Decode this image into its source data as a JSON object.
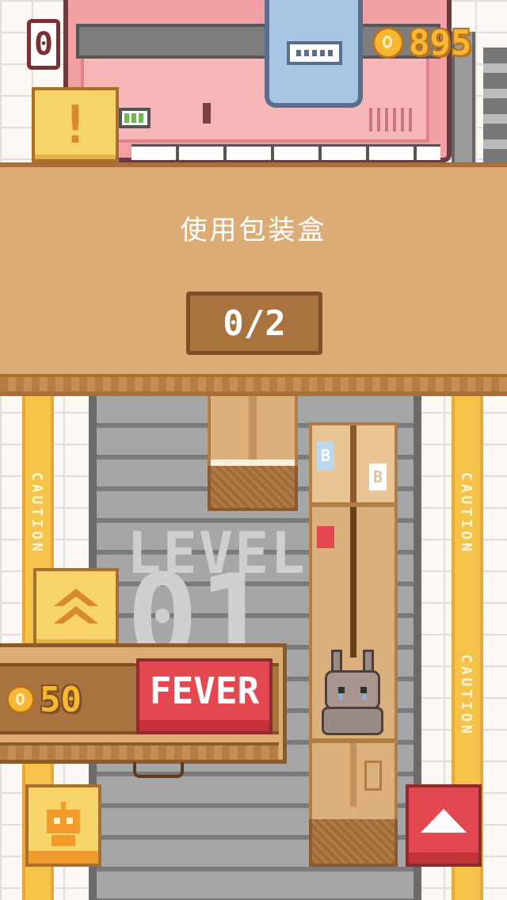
{
  "hud": {
    "score": "0",
    "coins": "895"
  },
  "banner": {
    "title": "使用包装盒",
    "progress": "0/2"
  },
  "machine": {
    "indicator": "!"
  },
  "side_stripes": {
    "label": "CAUTION"
  },
  "level": {
    "word": "LEVEL",
    "number": "01"
  },
  "fever_panel": {
    "cost": "50",
    "fever_label": "FEVER"
  },
  "box_labels": {
    "top": "B",
    "middle": "B"
  },
  "colors": {
    "banner": "#dcac76",
    "banner_border": "#a96f37",
    "progress_box": "#a8733f",
    "fever_red": "#e34850",
    "coin_gold": "#f7b733",
    "caution_yellow": "#f6c34a",
    "machine_pink": "#f2a0a4"
  },
  "icons": [
    "coin-icon",
    "double-chevron-up-icon",
    "robot-icon",
    "triangle-up-icon",
    "exclamation-icon",
    "bunny-character"
  ]
}
